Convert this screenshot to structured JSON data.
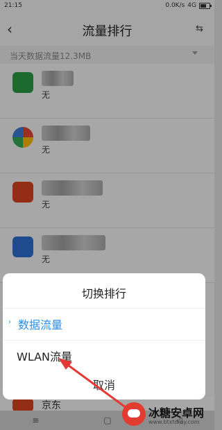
{
  "status": {
    "time": "21:15",
    "network": "0.0K/s",
    "signal": "4G"
  },
  "header": {
    "title": "流量排行",
    "back_icon": "chevron-left-icon",
    "switch_icon": "swap-icon"
  },
  "summary": {
    "text": "当天数据流量12.3MB"
  },
  "apps": [
    {
      "usage": "无",
      "icon_color": "#2a9d44",
      "icon": "mi-home-icon"
    },
    {
      "usage": "无",
      "icon_color": "#3b7ed6",
      "icon": "browser-icon"
    },
    {
      "usage": "无",
      "icon_color": "#d9431f",
      "icon": "video-icon"
    },
    {
      "usage": "无",
      "icon_color": "#2f6fd1",
      "icon": "cloud-icon"
    }
  ],
  "bottom_app": {
    "text": "京东",
    "icon": "jd-icon"
  },
  "sheet": {
    "title": "切换排行",
    "options": [
      {
        "label": "数据流量",
        "selected": true
      },
      {
        "label": "WLAN流量",
        "selected": false
      }
    ],
    "cancel": "取消"
  },
  "watermark": {
    "name": "冰糖安卓网",
    "url": "www.btxtdmy.com"
  },
  "colors": {
    "accent": "#2c8ee8",
    "annotation": "#e53935"
  }
}
